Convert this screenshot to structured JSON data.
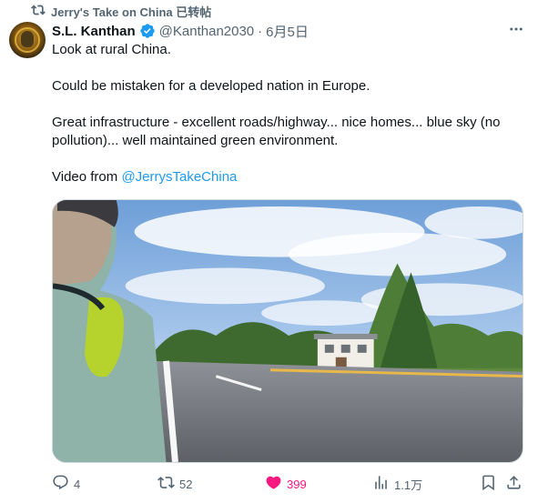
{
  "repost": {
    "text": "Jerry's Take on China 已转帖",
    "icon": "repost-icon"
  },
  "author": {
    "name": "S.L. Kanthan",
    "verified": true,
    "handle": "@Kanthan2030",
    "separator": "·",
    "date": "6月5日"
  },
  "tweet": {
    "line1": "Look at rural China.",
    "line2": "Could be mistaken for a developed nation in Europe.",
    "line3": "Great infrastructure - excellent roads/highway... nice homes... blue sky (no pollution)... well maintained green environment.",
    "video_prefix": "Video from ",
    "video_link": "@JerrysTakeChina"
  },
  "stats": {
    "replies": "4",
    "reposts": "52",
    "likes": "399",
    "views": "1.1万"
  },
  "colors": {
    "accent": "#1d9bf0",
    "like": "#f91880",
    "muted": "#536471"
  }
}
